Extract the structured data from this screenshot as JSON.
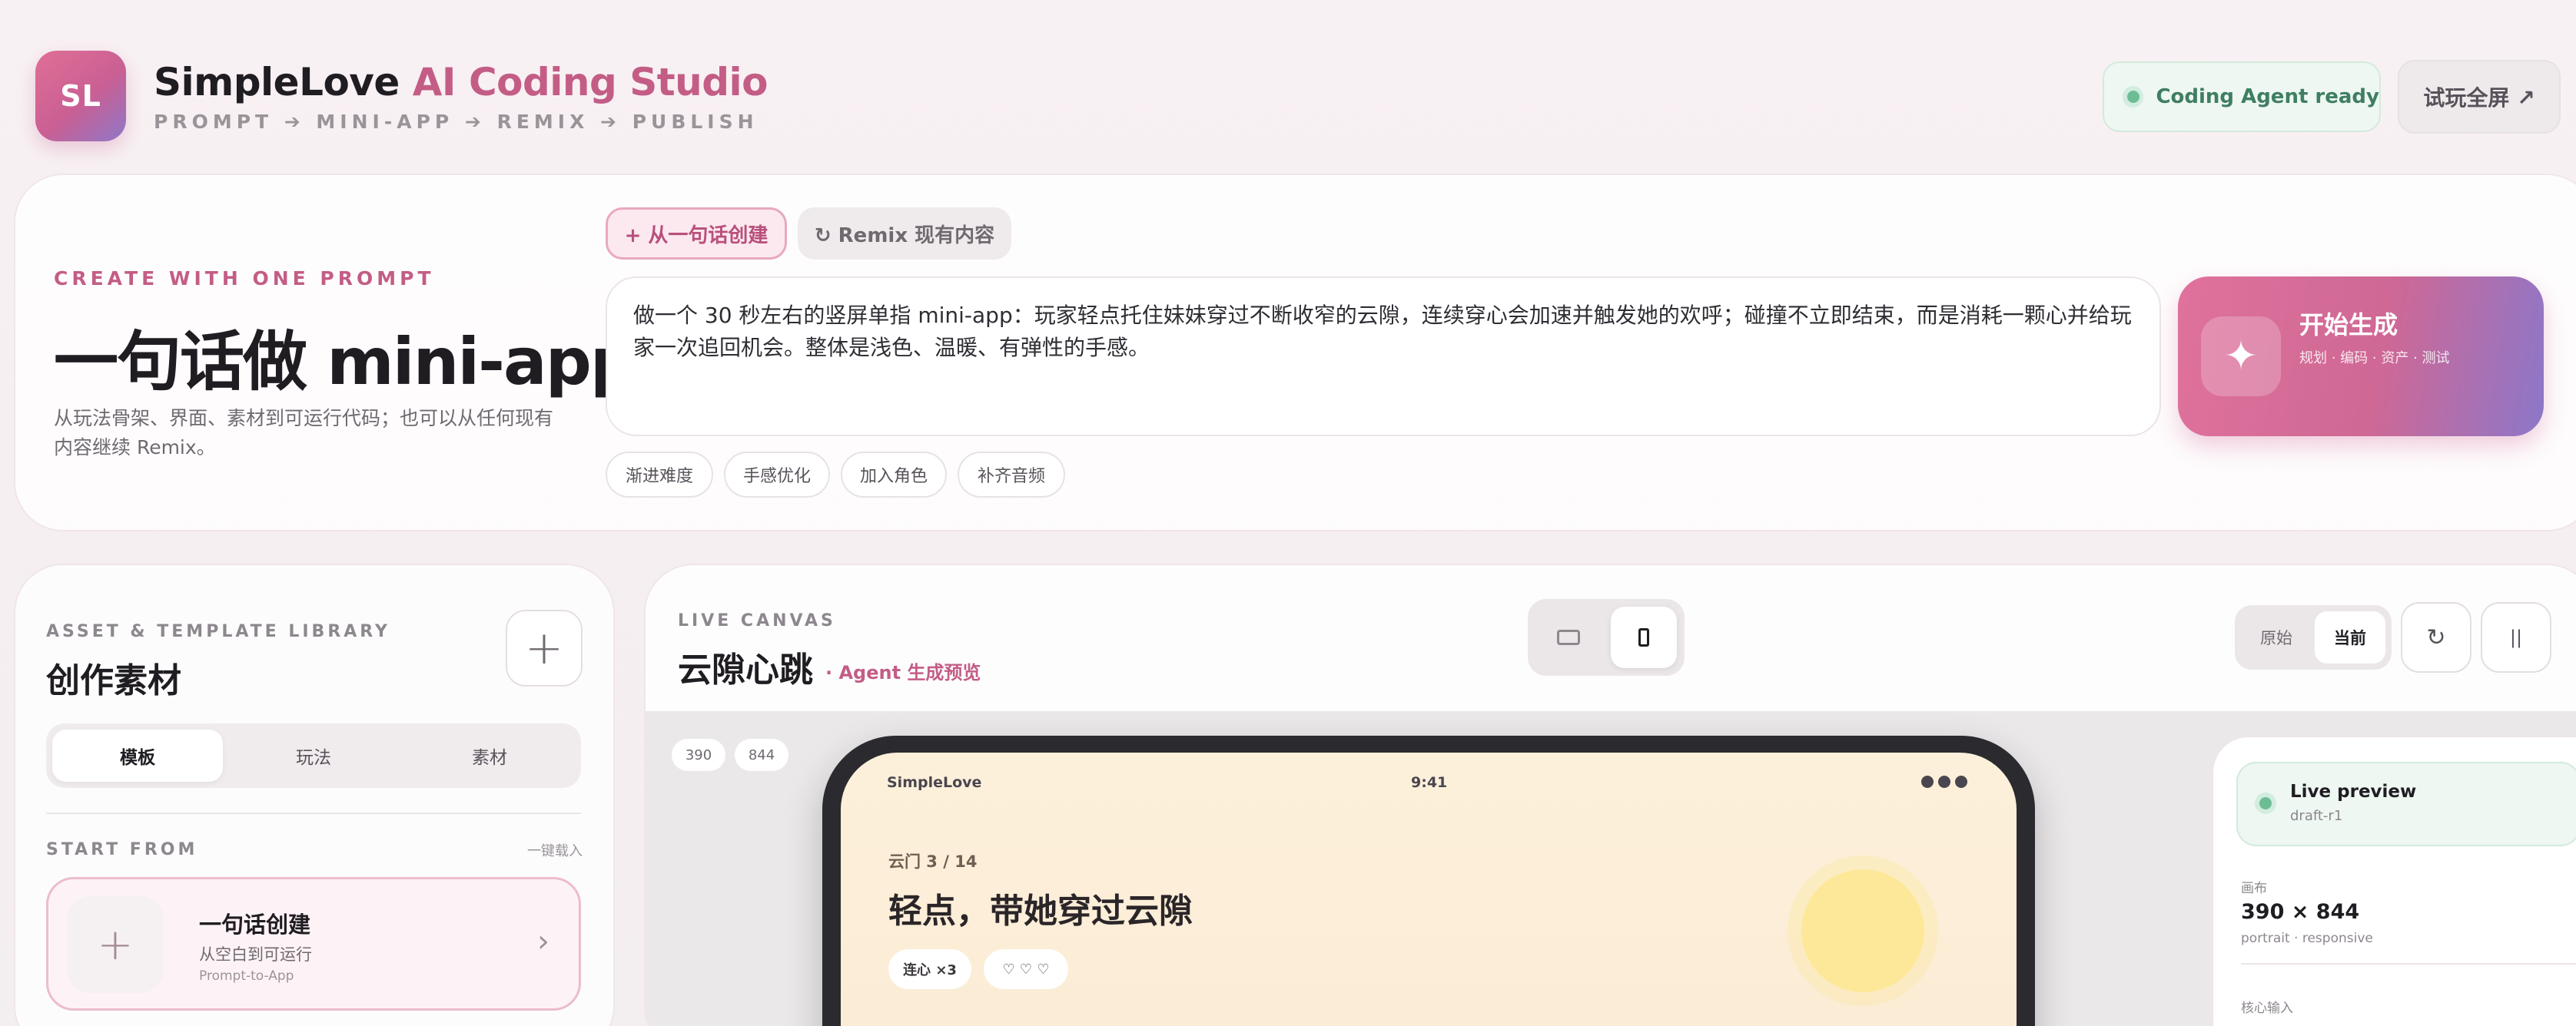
{
  "header": {
    "logo_text": "SL",
    "brand_main": "SimpleLove",
    "brand_accent": "AI Coding Studio",
    "subtitle": "PROMPT ➔ MINI-APP ➔ REMIX ➔ PUBLISH",
    "agent_status": "Coding Agent ready",
    "fullscreen_label": "试玩全屏 ↗"
  },
  "prompt_card": {
    "eyebrow": "CREATE WITH ONE PROMPT",
    "title": "一句话做 mini-app",
    "description": "从玩法骨架、界面、素材到可运行代码；也可以从任何现有内容继续 Remix。",
    "modes": [
      {
        "label": "+ 从一句话创建",
        "active": true
      },
      {
        "label": "↻ Remix 现有内容",
        "active": false
      }
    ],
    "prompt_text": "做一个 30 秒左右的竖屏单指 mini-app：玩家轻点托住妹妹穿过不断收窄的云隙，连续穿心会加速并触发她的欢呼；碰撞不立即结束，而是消耗一颗心并给玩家一次追回机会。整体是浅色、温暖、有弹性的手感。",
    "chips": [
      "渐进难度",
      "手感优化",
      "加入角色",
      "补齐音频"
    ],
    "generate": {
      "icon": "✦",
      "title": "开始生成",
      "subtitle": "规划 · 编码 · 资产 · 测试"
    }
  },
  "library": {
    "eyebrow": "ASSET & TEMPLATE LIBRARY",
    "title": "创作素材",
    "add_icon": "+",
    "tabs": [
      {
        "label": "模板",
        "active": true
      },
      {
        "label": "玩法",
        "active": false
      },
      {
        "label": "素材",
        "active": false
      }
    ],
    "start_from_label": "START FROM",
    "start_from_link": "一键载入",
    "start_card": {
      "icon": "+",
      "title": "一句话创建",
      "subtitle": "从空白到可运行",
      "tag": "Prompt-to-App",
      "chevron": "›"
    }
  },
  "canvas": {
    "eyebrow": "LIVE CANVAS",
    "title": "云隙心跳",
    "title_sub": "· Agent 生成预览",
    "version_tabs": [
      {
        "label": "原始",
        "active": false
      },
      {
        "label": "当前",
        "active": true
      }
    ],
    "refresh_icon": "↻",
    "pause_icon": "||",
    "dims": [
      "390",
      "844"
    ],
    "phone": {
      "app_name": "SimpleLove",
      "time": "9:41",
      "level": "云门 3 / 14",
      "headline": "轻点，带她穿过云隙",
      "chips": [
        "连心 ×3",
        "♡ ♡ ♡"
      ]
    },
    "preview_panel": {
      "live_title": "Live preview",
      "live_sub": "draft-r1",
      "canvas_label": "画布",
      "canvas_value": "390 × 844",
      "canvas_note": "portrait · responsive",
      "input_label": "核心输入"
    }
  },
  "colors": {
    "accent": "#c35d86",
    "ready_green": "#6dbd94",
    "gradient_start": "#df729c",
    "gradient_end": "#8c77c9"
  }
}
